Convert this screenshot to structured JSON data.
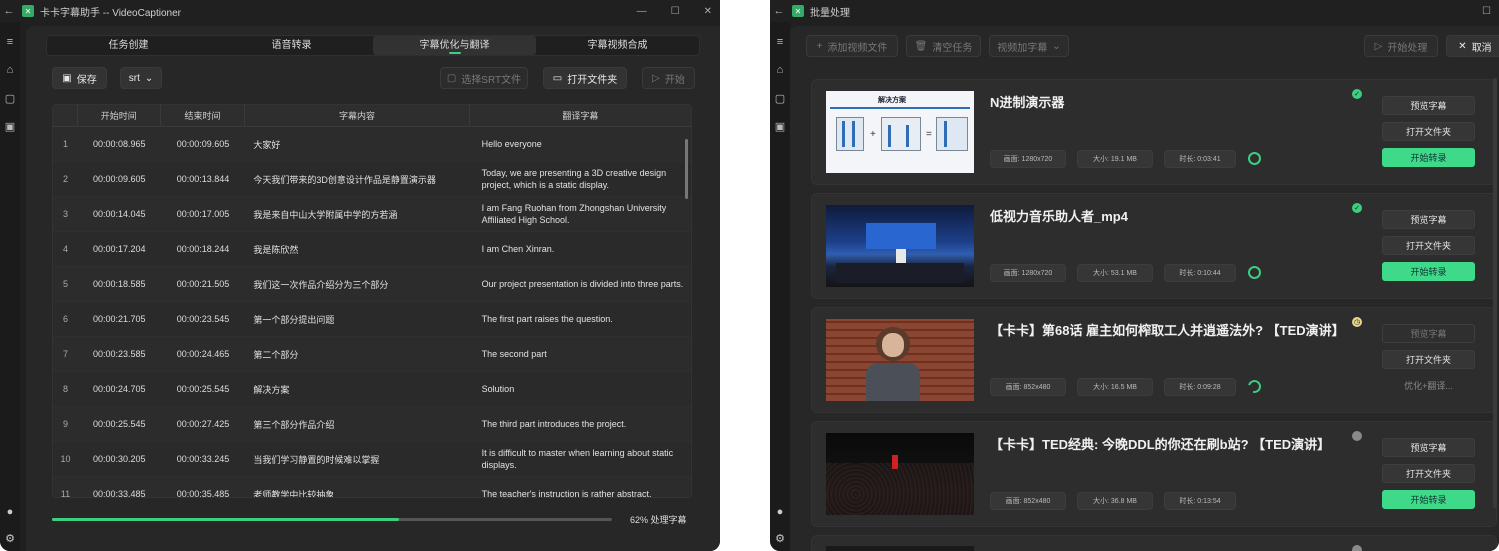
{
  "left_window": {
    "title": "卡卡字幕助手 -- VideoCaptioner",
    "tabs": [
      {
        "label": "任务创建"
      },
      {
        "label": "语音转录"
      },
      {
        "label": "字幕优化与翻译"
      },
      {
        "label": "字幕视频合成"
      }
    ],
    "toolbar": {
      "save_label": "保存",
      "format_value": "srt",
      "select_srt_label": "选择SRT文件",
      "open_folder_label": "打开文件夹",
      "start_label": "开始"
    },
    "table": {
      "headers": [
        "开始时间",
        "结束时间",
        "字幕内容",
        "翻译字幕"
      ],
      "rows": [
        {
          "n": "1",
          "start": "00:00:08.965",
          "end": "00:00:09.605",
          "text": "大家好",
          "trans": "Hello everyone"
        },
        {
          "n": "2",
          "start": "00:00:09.605",
          "end": "00:00:13.844",
          "text": "今天我们带来的3D创意设计作品是静置演示器",
          "trans": "Today, we are presenting a 3D creative design project, which is a static display."
        },
        {
          "n": "3",
          "start": "00:00:14.045",
          "end": "00:00:17.005",
          "text": "我是来自中山大学附属中学的方若涵",
          "trans": "I am Fang Ruohan from Zhongshan University Affiliated High School."
        },
        {
          "n": "4",
          "start": "00:00:17.204",
          "end": "00:00:18.244",
          "text": "我是陈欣然",
          "trans": "I am Chen Xinran."
        },
        {
          "n": "5",
          "start": "00:00:18.585",
          "end": "00:00:21.505",
          "text": "我们这一次作品介绍分为三个部分",
          "trans": "Our project presentation is divided into three parts."
        },
        {
          "n": "6",
          "start": "00:00:21.705",
          "end": "00:00:23.545",
          "text": "第一个部分提出问题",
          "trans": "The first part raises the question."
        },
        {
          "n": "7",
          "start": "00:00:23.585",
          "end": "00:00:24.465",
          "text": "第二个部分",
          "trans": "The second part"
        },
        {
          "n": "8",
          "start": "00:00:24.705",
          "end": "00:00:25.545",
          "text": "解决方案",
          "trans": "Solution"
        },
        {
          "n": "9",
          "start": "00:00:25.545",
          "end": "00:00:27.425",
          "text": "第三个部分作品介绍",
          "trans": "The third part introduces the project."
        },
        {
          "n": "10",
          "start": "00:00:30.205",
          "end": "00:00:33.245",
          "text": "当我们学习静置的时候难以掌握",
          "trans": "It is difficult to master when learning about static displays."
        },
        {
          "n": "11",
          "start": "00:00:33.485",
          "end": "00:00:35.485",
          "text": "老师教学中比较抽象",
          "trans": "The teacher's instruction is rather abstract."
        }
      ]
    },
    "progress": {
      "value": 62,
      "label": "62% 处理字幕"
    }
  },
  "right_window": {
    "title": "批量处理",
    "toolbar": {
      "add_label": "添加视频文件",
      "clear_label": "清空任务",
      "mode_value": "视频加字幕",
      "start_label": "开始处理",
      "cancel_label": "取消"
    },
    "cards": [
      {
        "title": "N进制演示器",
        "resolution": "画面: 1280x720",
        "size": "大小: 19.1 MB",
        "duration": "时长: 0:03:41",
        "status": "done",
        "preview_label": "预览字幕",
        "open_label": "打开文件夹",
        "action_label": "开始转录",
        "thumb_heading": "解决方案"
      },
      {
        "title": "低视力音乐助人者_mp4",
        "resolution": "画面: 1280x720",
        "size": "大小: 53.1 MB",
        "duration": "时长: 0:10:44",
        "status": "done",
        "preview_label": "预览字幕",
        "open_label": "打开文件夹",
        "action_label": "开始转录"
      },
      {
        "title": "【卡卡】第68话 雇主如何榨取工人并逍遥法外? 【TED演讲】",
        "resolution": "画面: 852x480",
        "size": "大小: 16.5 MB",
        "duration": "时长: 0:09:28",
        "status": "processing",
        "preview_label": "预览字幕",
        "open_label": "打开文件夹",
        "action_label": "优化+翻译..."
      },
      {
        "title": "【卡卡】TED经典: 今晚DDL的你还在刷b站? 【TED演讲】",
        "resolution": "画面: 852x480",
        "size": "大小: 36.8 MB",
        "duration": "时长: 0:13:54",
        "status": "waiting",
        "preview_label": "预览字幕",
        "open_label": "打开文件夹",
        "action_label": "开始转录"
      }
    ]
  },
  "colors": {
    "accent": "#3ccf7f",
    "bg": "#202020",
    "panel": "#272727"
  }
}
